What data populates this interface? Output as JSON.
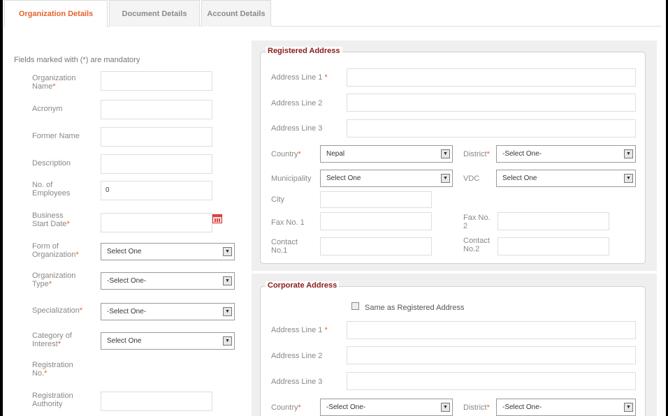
{
  "tabs": [
    {
      "label": "Organization Details",
      "active": true
    },
    {
      "label": "Document Details",
      "active": false
    },
    {
      "label": "Account Details",
      "active": false
    }
  ],
  "mandatory_note": "Fields marked with (*) are mandatory",
  "left_form": {
    "org_name_label": "Organization Name",
    "acronym_label": "Acronym",
    "former_name_label": "Former Name",
    "description_label": "Description",
    "employees_label": "No. of Employees",
    "employees_value": "0",
    "start_date_label": "Business Start Date",
    "form_of_org_label": "Form of Organization",
    "form_of_org_value": "Select One",
    "org_type_label": "Organization Type",
    "org_type_value": "-Select One-",
    "specialization_label": "Specialization",
    "specialization_value": "-Select One-",
    "category_label": "Category of Interest",
    "category_value": "Select One",
    "reg_no_label": "Registration No.",
    "reg_authority_label": "Registration Authority"
  },
  "registered": {
    "legend": "Registered Address",
    "line1_label": "Address Line 1",
    "line2_label": "Address Line 2",
    "line3_label": "Address Line 3",
    "country_label": "Country",
    "country_value": "Nepal",
    "district_label": "District",
    "district_value": "-Select One-",
    "municipality_label": "Municipality",
    "municipality_value": "Select One",
    "vdc_label": "VDC",
    "vdc_value": "Select One",
    "city_label": "City",
    "fax1_label": "Fax No. 1",
    "fax2_label": "Fax No. 2",
    "contact1_label": "Contact No.1",
    "contact2_label": "Contact No.2"
  },
  "corporate": {
    "legend": "Corporate Address",
    "same_as_label": "Same as Registered Address",
    "line1_label": "Address Line 1",
    "line2_label": "Address Line 2",
    "line3_label": "Address Line 3",
    "country_label": "Country",
    "country_value": "-Select One-",
    "district_label": "District",
    "district_value": "-Select One-"
  },
  "required_mark": "*",
  "icons": {
    "select_arrow": "chevron-down-icon",
    "calendar": "calendar-icon"
  },
  "colors": {
    "active_tab": "#e8612c",
    "legend": "#8b1a1a",
    "required": "#e8612c"
  }
}
